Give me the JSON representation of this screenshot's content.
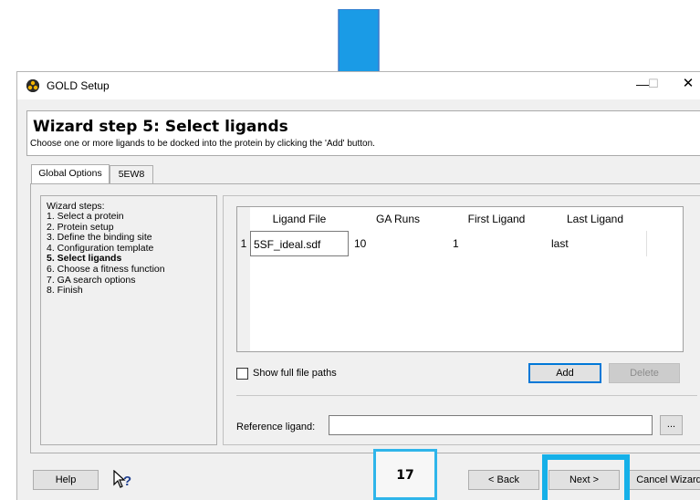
{
  "window": {
    "title": "GOLD Setup",
    "controls": {
      "minimize": "—",
      "maximize": "☐",
      "close": "✕"
    }
  },
  "header": {
    "title": "Wizard step 5: Select ligands",
    "description": "Choose one or more ligands to be docked into the protein by clicking the 'Add' button."
  },
  "tabs": [
    {
      "label": "Global Options",
      "active": true
    },
    {
      "label": "5EW8",
      "active": false
    }
  ],
  "wizard_steps": {
    "heading": "Wizard steps:",
    "items": [
      {
        "label": "1. Select a protein",
        "active": false
      },
      {
        "label": "2. Protein setup",
        "active": false
      },
      {
        "label": "3. Define the binding site",
        "active": false
      },
      {
        "label": "4. Configuration template",
        "active": false
      },
      {
        "label": "5. Select ligands",
        "active": true
      },
      {
        "label": "6. Choose a fitness function",
        "active": false
      },
      {
        "label": "7. GA search options",
        "active": false
      },
      {
        "label": "8. Finish",
        "active": false
      }
    ]
  },
  "ligand_table": {
    "columns": [
      "Ligand File",
      "GA Runs",
      "First Ligand",
      "Last Ligand"
    ],
    "rows": [
      {
        "index": "1",
        "ligand_file": "5SF_ideal.sdf",
        "ga_runs": "10",
        "first_ligand": "1",
        "last_ligand": "last"
      }
    ]
  },
  "options": {
    "show_full_paths_label": "Show full file paths",
    "show_full_paths_checked": false,
    "add_label": "Add",
    "delete_label": "Delete"
  },
  "reference_ligand": {
    "label": "Reference ligand:",
    "value": "",
    "browse_label": "..."
  },
  "footer": {
    "help_label": "Help",
    "back_label": "< Back",
    "next_label": "Next >",
    "cancel_label": "Cancel Wizard"
  },
  "overlay": {
    "page_number": "17",
    "highlight_color": "#15b0e8",
    "arrow_color": "#1a9be6",
    "icons": [
      "down-arrow-annotation",
      "whats-this-icon",
      "gold-app-icon"
    ]
  }
}
